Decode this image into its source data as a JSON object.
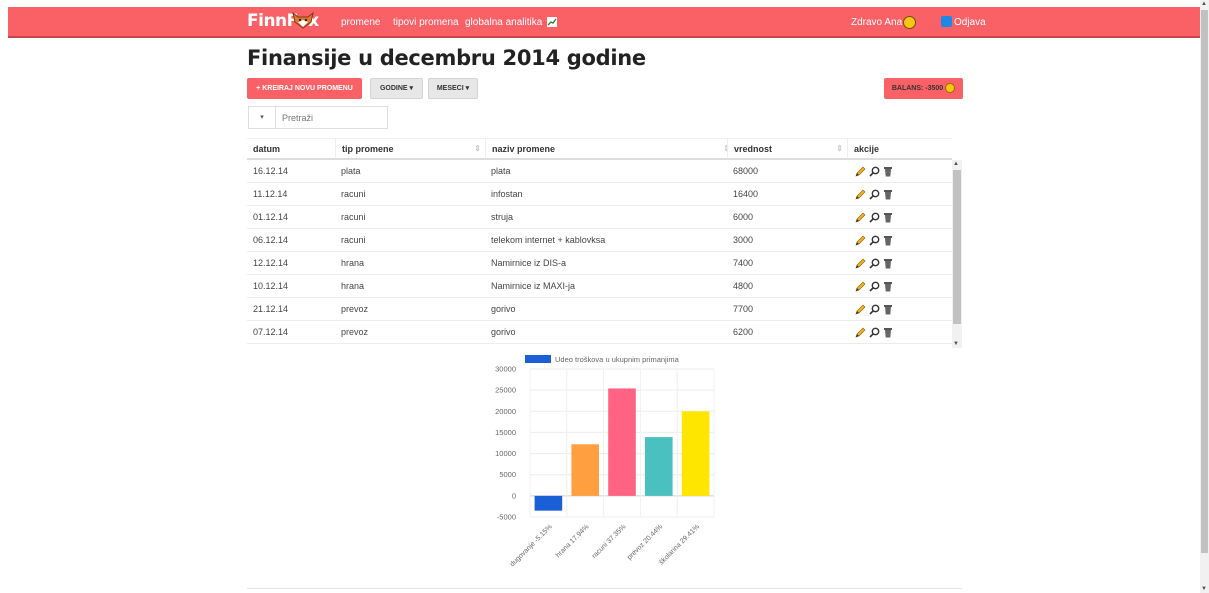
{
  "nav": {
    "brand": "FinnFox",
    "links": [
      "promene",
      "tipovi promena",
      "globalna analitika"
    ],
    "greeting": "Zdravo Ana |",
    "logout": "Odjava"
  },
  "page": {
    "title": "Finansije u decembru 2014 godine"
  },
  "toolbar": {
    "create_label": "+ KREIRAJ NOVU PROMENU",
    "years_label": "GODINE",
    "months_label": "MESECI",
    "balance_label": "BALANS: -3500"
  },
  "search": {
    "placeholder": "Pretraži",
    "dropdown": "▾"
  },
  "table": {
    "headers": [
      "datum",
      "tip promene",
      "naziv promene",
      "vrednost",
      "akcije"
    ],
    "rows": [
      [
        "16.12.14",
        "plata",
        "plata",
        "68000"
      ],
      [
        "11.12.14",
        "racuni",
        "infostan",
        "16400"
      ],
      [
        "01.12.14",
        "racuni",
        "struja",
        "6000"
      ],
      [
        "06.12.14",
        "racuni",
        "telekom internet + kablovksa",
        "3000"
      ],
      [
        "12.12.14",
        "hrana",
        "Namirnice iz DIS-a",
        "7400"
      ],
      [
        "10.12.14",
        "hrana",
        "Namirnice iz MAXI-ja",
        "4800"
      ],
      [
        "21.12.14",
        "prevoz",
        "gorivo",
        "7700"
      ],
      [
        "07.12.14",
        "prevoz",
        "gorivo",
        "6200"
      ]
    ],
    "action_icons": [
      "pencil-icon",
      "magnifier-icon",
      "trash-icon"
    ]
  },
  "colors": {
    "accent": "#f96167",
    "positive": "#5cb85c"
  },
  "chart_data": {
    "type": "bar",
    "legend": [
      "Udeo troškova u ukupnim primanjima"
    ],
    "categories": [
      "dugovanje -5.15%",
      "hrana 17.94%",
      "racuni 37.35%",
      "prevoz 20.44%",
      "školarina 29.41%"
    ],
    "values": [
      -3500,
      12200,
      25400,
      13900,
      20000
    ],
    "colors": [
      "#1a5fd6",
      "#ff9f40",
      "#ff6384",
      "#4bc0c0",
      "#ffe600"
    ],
    "yticks": [
      30000,
      25000,
      20000,
      15000,
      10000,
      5000,
      0,
      -5000
    ],
    "ylim": [
      -5000,
      30000
    ],
    "grid": true,
    "legend_position": "top"
  }
}
